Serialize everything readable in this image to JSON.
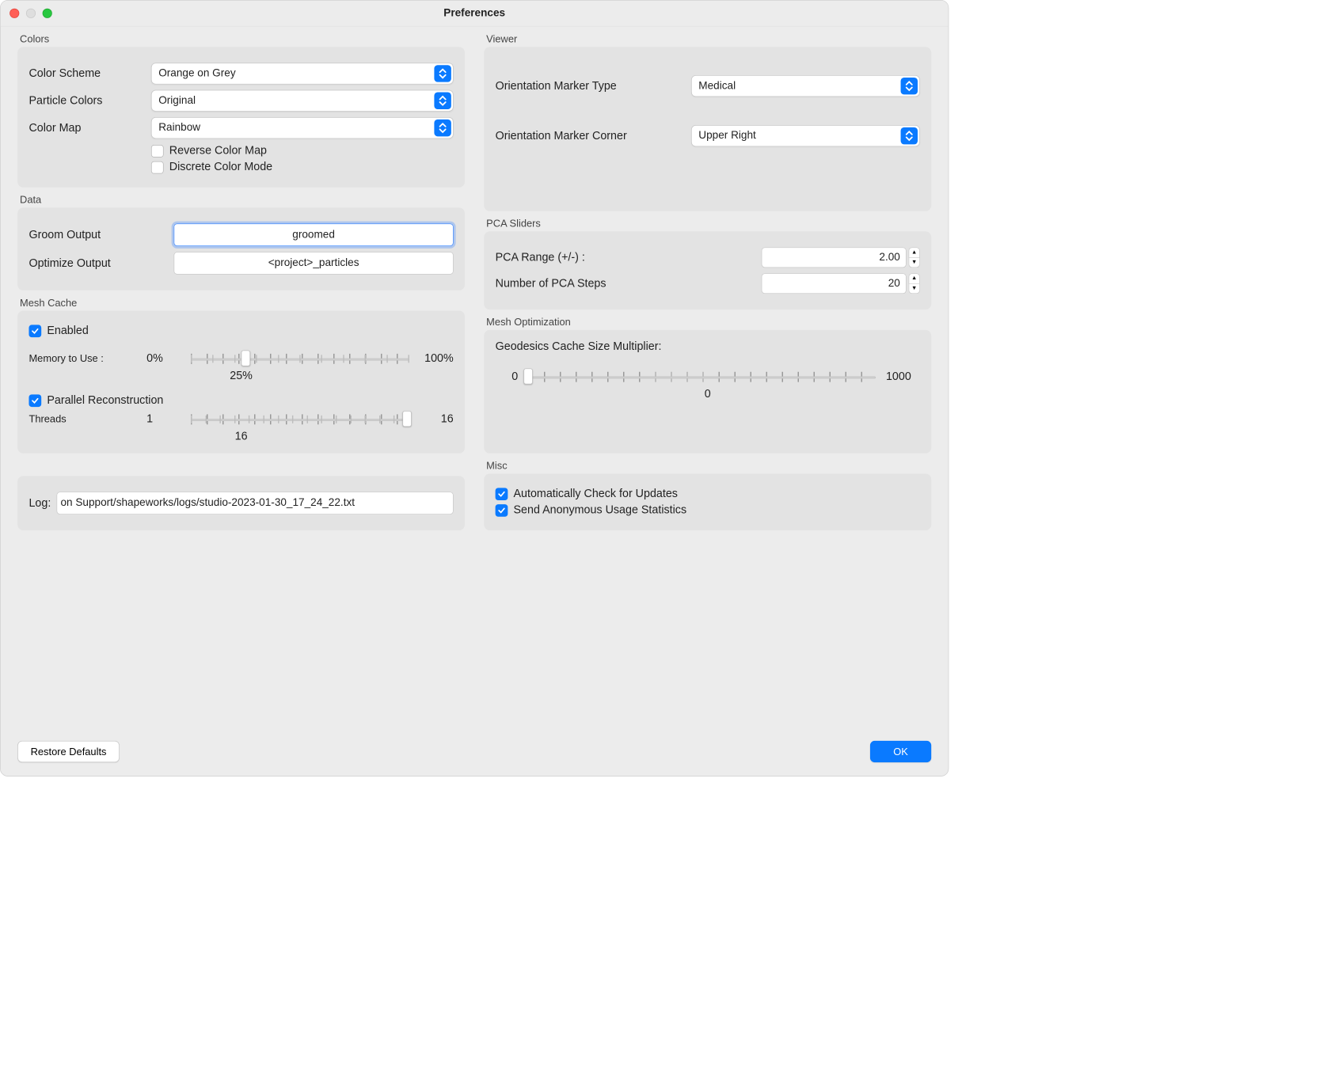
{
  "window": {
    "title": "Preferences"
  },
  "colors": {
    "legend": "Colors",
    "scheme_label": "Color Scheme",
    "scheme_value": "Orange on Grey",
    "particle_label": "Particle Colors",
    "particle_value": "Original",
    "map_label": "Color Map",
    "map_value": "Rainbow",
    "reverse_label": "Reverse Color Map",
    "discrete_label": "Discrete Color Mode"
  },
  "viewer": {
    "legend": "Viewer",
    "type_label": "Orientation Marker Type",
    "type_value": "Medical",
    "corner_label": "Orientation Marker Corner",
    "corner_value": "Upper Right"
  },
  "data": {
    "legend": "Data",
    "groom_label": "Groom Output",
    "groom_value": "groomed",
    "optimize_label": "Optimize Output",
    "optimize_value": "<project>_particles"
  },
  "pca": {
    "legend": "PCA Sliders",
    "range_label": "PCA Range (+/-) :",
    "range_value": "2.00",
    "steps_label": "Number of PCA Steps",
    "steps_value": "20"
  },
  "meshcache": {
    "legend": "Mesh Cache",
    "enabled_label": "Enabled",
    "memory_label": "Memory to Use :",
    "memory_min": "0%",
    "memory_max": "100%",
    "memory_value": "25%",
    "parallel_label": "Parallel Reconstruction",
    "threads_label": "Threads",
    "threads_min": "1",
    "threads_max": "16",
    "threads_value": "16"
  },
  "meshopt": {
    "legend": "Mesh Optimization",
    "geodesics_label": "Geodesics Cache Size Multiplier:",
    "geo_min": "0",
    "geo_max": "1000",
    "geo_value": "0"
  },
  "misc": {
    "legend": "Misc",
    "updates_label": "Automatically Check for Updates",
    "stats_label": "Send Anonymous Usage Statistics"
  },
  "log": {
    "label": "Log:",
    "value": "on Support/shapeworks/logs/studio-2023-01-30_17_24_22.txt"
  },
  "buttons": {
    "restore": "Restore Defaults",
    "ok": "OK"
  }
}
